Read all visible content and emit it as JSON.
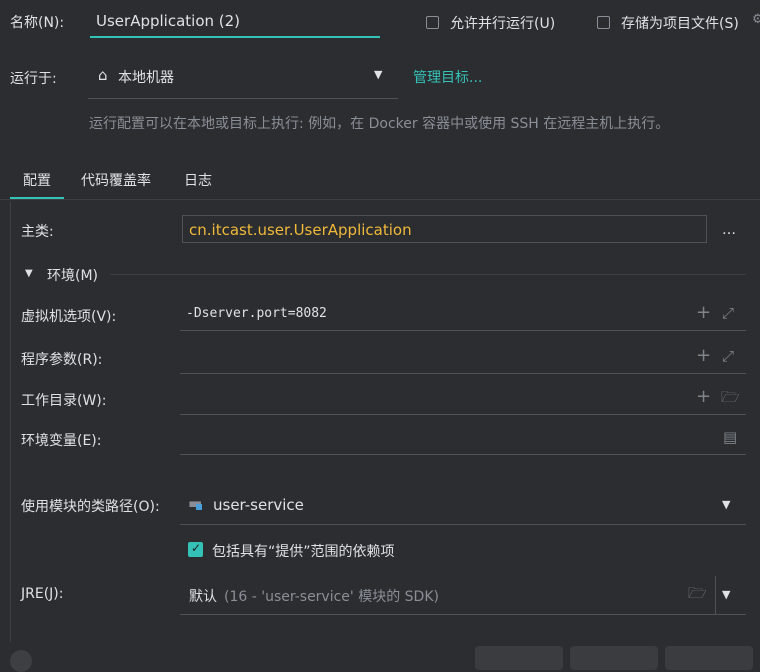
{
  "name": {
    "label": "名称(N):",
    "value": "UserApplication (2)"
  },
  "checks": {
    "parallel": "允许并行运行(U)",
    "store": "存储为项目文件(S)"
  },
  "run_on": {
    "label": "运行于:",
    "value": "本地机器",
    "manage": "管理目标...",
    "hint": "运行配置可以在本地或目标上执行: 例如，在 Docker 容器中或使用 SSH 在远程主机上执行。"
  },
  "tabs": [
    {
      "label": "配置"
    },
    {
      "label": "代码覆盖率"
    },
    {
      "label": "日志"
    }
  ],
  "main_class": {
    "label": "主类:",
    "value": "cn.itcast.user.UserApplication"
  },
  "env_section": {
    "label": "环境(M)"
  },
  "vm_options": {
    "label": "虚拟机选项(V):",
    "value": "-Dserver.port=8082"
  },
  "program_args": {
    "label": "程序参数(R):",
    "value": ""
  },
  "work_dir": {
    "label": "工作目录(W):",
    "value": ""
  },
  "env_vars": {
    "label": "环境变量(E):",
    "value": ""
  },
  "module": {
    "label": "使用模块的类路径(O):",
    "value": "user-service"
  },
  "provided": {
    "label": "包括具有“提供”范围的依赖项"
  },
  "jre": {
    "label": "JRE(J):",
    "default": "默认",
    "detail": "(16 - 'user-service' 模块的 SDK)"
  },
  "colors": {
    "accent": "#35c2b6",
    "class_text": "#f0b93a",
    "bg": "#2b2d30"
  }
}
